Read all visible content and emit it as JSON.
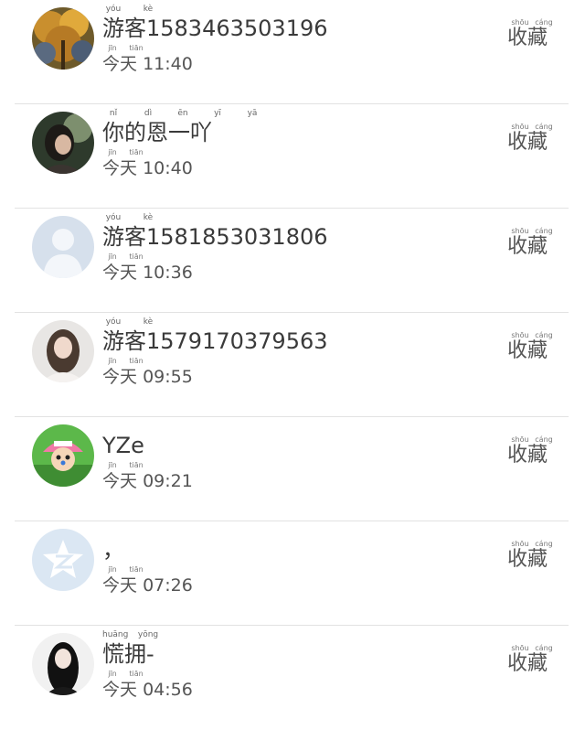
{
  "items": [
    {
      "name": "游客1583463503196",
      "name_pinyin": [
        "yóu",
        "kè"
      ],
      "time_label": "今天",
      "time_pinyin": [
        "jīn",
        "tiān"
      ],
      "time": "11:40",
      "avatar_icon": "autumn-tree-photo-icon",
      "action_label": "收藏",
      "action_pinyin": [
        "shōu",
        "cáng"
      ]
    },
    {
      "name": "你的恩一吖",
      "name_pinyin": [
        "nǐ",
        "dì",
        "ēn",
        "yī",
        "yā"
      ],
      "time_label": "今天",
      "time_pinyin": [
        "jīn",
        "tiān"
      ],
      "time": "10:40",
      "avatar_icon": "girl-photo-icon",
      "action_label": "收藏",
      "action_pinyin": [
        "shōu",
        "cáng"
      ]
    },
    {
      "name": "游客1581853031806",
      "name_pinyin": [
        "yóu",
        "kè"
      ],
      "time_label": "今天",
      "time_pinyin": [
        "jīn",
        "tiān"
      ],
      "time": "10:36",
      "avatar_icon": "default-user-silhouette-icon",
      "action_label": "收藏",
      "action_pinyin": [
        "shōu",
        "cáng"
      ]
    },
    {
      "name": "游客1579170379563",
      "name_pinyin": [
        "yóu",
        "kè"
      ],
      "time_label": "今天",
      "time_pinyin": [
        "jīn",
        "tiān"
      ],
      "time": "09:55",
      "avatar_icon": "girl-portrait-icon",
      "action_label": "收藏",
      "action_pinyin": [
        "shōu",
        "cáng"
      ]
    },
    {
      "name": "YZe",
      "name_pinyin": [],
      "time_label": "今天",
      "time_pinyin": [
        "jīn",
        "tiān"
      ],
      "time": "09:21",
      "avatar_icon": "cartoon-character-icon",
      "action_label": "收藏",
      "action_pinyin": [
        "shōu",
        "cáng"
      ]
    },
    {
      "name": "，",
      "name_pinyin": [],
      "time_label": "今天",
      "time_pinyin": [
        "jīn",
        "tiān"
      ],
      "time": "07:26",
      "avatar_icon": "qzone-star-logo-icon",
      "action_label": "收藏",
      "action_pinyin": [
        "shōu",
        "cáng"
      ]
    },
    {
      "name": "慌拥-",
      "name_pinyin": [
        "huāng",
        "yōng"
      ],
      "time_label": "今天",
      "time_pinyin": [
        "jīn",
        "tiān"
      ],
      "time": "04:56",
      "avatar_icon": "dark-hair-girl-photo-icon",
      "action_label": "收藏",
      "action_pinyin": [
        "shōu",
        "cáng"
      ]
    }
  ]
}
